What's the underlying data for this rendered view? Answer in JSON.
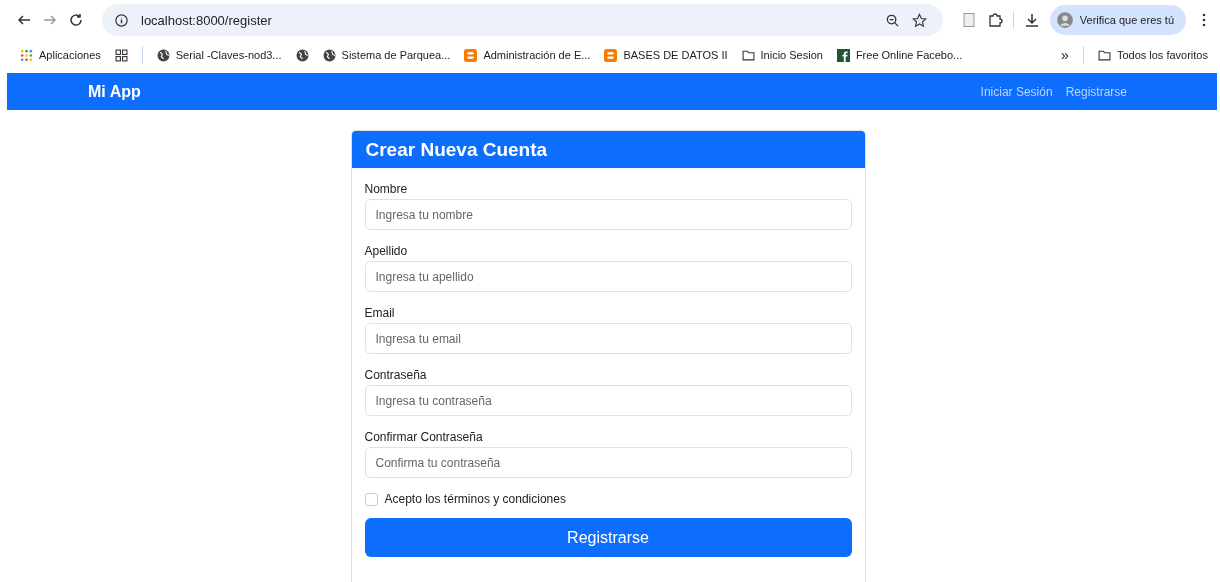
{
  "browser": {
    "url": "localhost:8000/register",
    "profile": "Verifica que eres tú",
    "bookmarks": [
      {
        "kind": "apps",
        "label": "Aplicaciones"
      },
      {
        "kind": "grid"
      },
      {
        "kind": "globe",
        "label": "Serial -Claves-nod3..."
      },
      {
        "kind": "globe"
      },
      {
        "kind": "globe",
        "label": "Sistema de Parquea..."
      },
      {
        "kind": "blogger",
        "label": "Administración de E..."
      },
      {
        "kind": "blogger",
        "label": "BASES DE DATOS II"
      },
      {
        "kind": "folder",
        "label": "Inicio Sesion"
      },
      {
        "kind": "facebook",
        "label": "Free Online Facebo..."
      }
    ],
    "more": "»",
    "all_bookmarks": "Todos los favoritos"
  },
  "navbar": {
    "brand": "Mi App",
    "links": [
      "Iniciar Sesión",
      "Registrarse"
    ]
  },
  "card": {
    "title": "Crear Nueva Cuenta",
    "fields": [
      {
        "label": "Nombre",
        "placeholder": "Ingresa tu nombre"
      },
      {
        "label": "Apellido",
        "placeholder": "Ingresa tu apellido"
      },
      {
        "label": "Email",
        "placeholder": "Ingresa tu email"
      },
      {
        "label": "Contraseña",
        "placeholder": "Ingresa tu contraseña"
      },
      {
        "label": "Confirmar Contraseña",
        "placeholder": "Confirma tu contraseña"
      }
    ],
    "terms": {
      "label": "Acepto los términos y condiciones",
      "checked": false
    },
    "submit": "Registrarse"
  }
}
